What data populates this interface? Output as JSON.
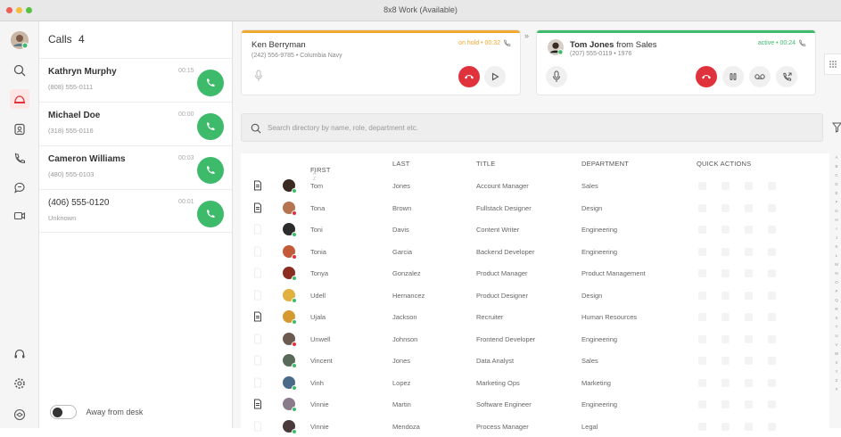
{
  "window": {
    "title": "8x8 Work (Available)"
  },
  "calls_panel": {
    "title": "Calls",
    "count": "4",
    "items": [
      {
        "name": "Kathryn Murphy",
        "phone": "(808) 555-0111",
        "time": "00:15"
      },
      {
        "name": "Michael Doe",
        "phone": "(318) 555-0116",
        "time": "00:00"
      },
      {
        "name": "Cameron Williams",
        "phone": "(480) 555-0103",
        "time": "00:03"
      },
      {
        "name": "(406) 555-0120",
        "phone": "Unknown",
        "time": "00:01"
      }
    ],
    "away_label": "Away from desk"
  },
  "active_calls": [
    {
      "name": "Ken Berryman",
      "sub": "(242) 556-9785 • Columbia Navy",
      "status": "on hold • 00:32"
    },
    {
      "name_bold": "Tom Jones",
      "name_rest": " from Sales",
      "sub": "(207) 555-0119 • 1976",
      "status": "active • 00:24"
    }
  ],
  "search": {
    "placeholder": "Search directory by name, role, department etc."
  },
  "table": {
    "headers": {
      "first": "FIRST",
      "first_sort": "↑ A-Z",
      "last": "LAST",
      "title": "TITLE",
      "department": "DEPARTMENT",
      "quick_actions": "QUICK ACTIONS"
    },
    "rows": [
      {
        "first": "Tom",
        "last": "Jones",
        "title": "Account Manager",
        "department": "Sales"
      },
      {
        "first": "Tona",
        "last": "Brown",
        "title": "Fullstack Designer",
        "department": "Design"
      },
      {
        "first": "Toni",
        "last": "Davis",
        "title": "Content Writer",
        "department": "Engineering"
      },
      {
        "first": "Tonia",
        "last": "Garcia",
        "title": "Backend Developer",
        "department": "Engineering"
      },
      {
        "first": "Tonya",
        "last": "Gonzalez",
        "title": "Product Manager",
        "department": "Product Management"
      },
      {
        "first": "Udell",
        "last": "Hernancez",
        "title": "Product Designer",
        "department": "Design"
      },
      {
        "first": "Ujala",
        "last": "Jackson",
        "title": "Recruiter",
        "department": "Human Resources"
      },
      {
        "first": "Unwell",
        "last": "Johnson",
        "title": "Frontend Developer",
        "department": "Engineering"
      },
      {
        "first": "Vincent",
        "last": "Jones",
        "title": "Data Analyst",
        "department": "Sales"
      },
      {
        "first": "Vinh",
        "last": "Lopez",
        "title": "Marketing Ops",
        "department": "Marketing"
      },
      {
        "first": "Vinnie",
        "last": "Martin",
        "title": "Software Engineer",
        "department": "Engineering"
      },
      {
        "first": "Vinnie",
        "last": "Mendoza",
        "title": "Process Manager",
        "department": "Legal"
      }
    ]
  },
  "alphabet": "A B C D E F G H I J K L M N O P Q R S T U V W X Y Z #",
  "colors": {
    "accent_red": "#e0323c",
    "answer_green": "#3dbb6b",
    "hold_orange": "#f0a830",
    "active_green": "#3dbb6b"
  }
}
